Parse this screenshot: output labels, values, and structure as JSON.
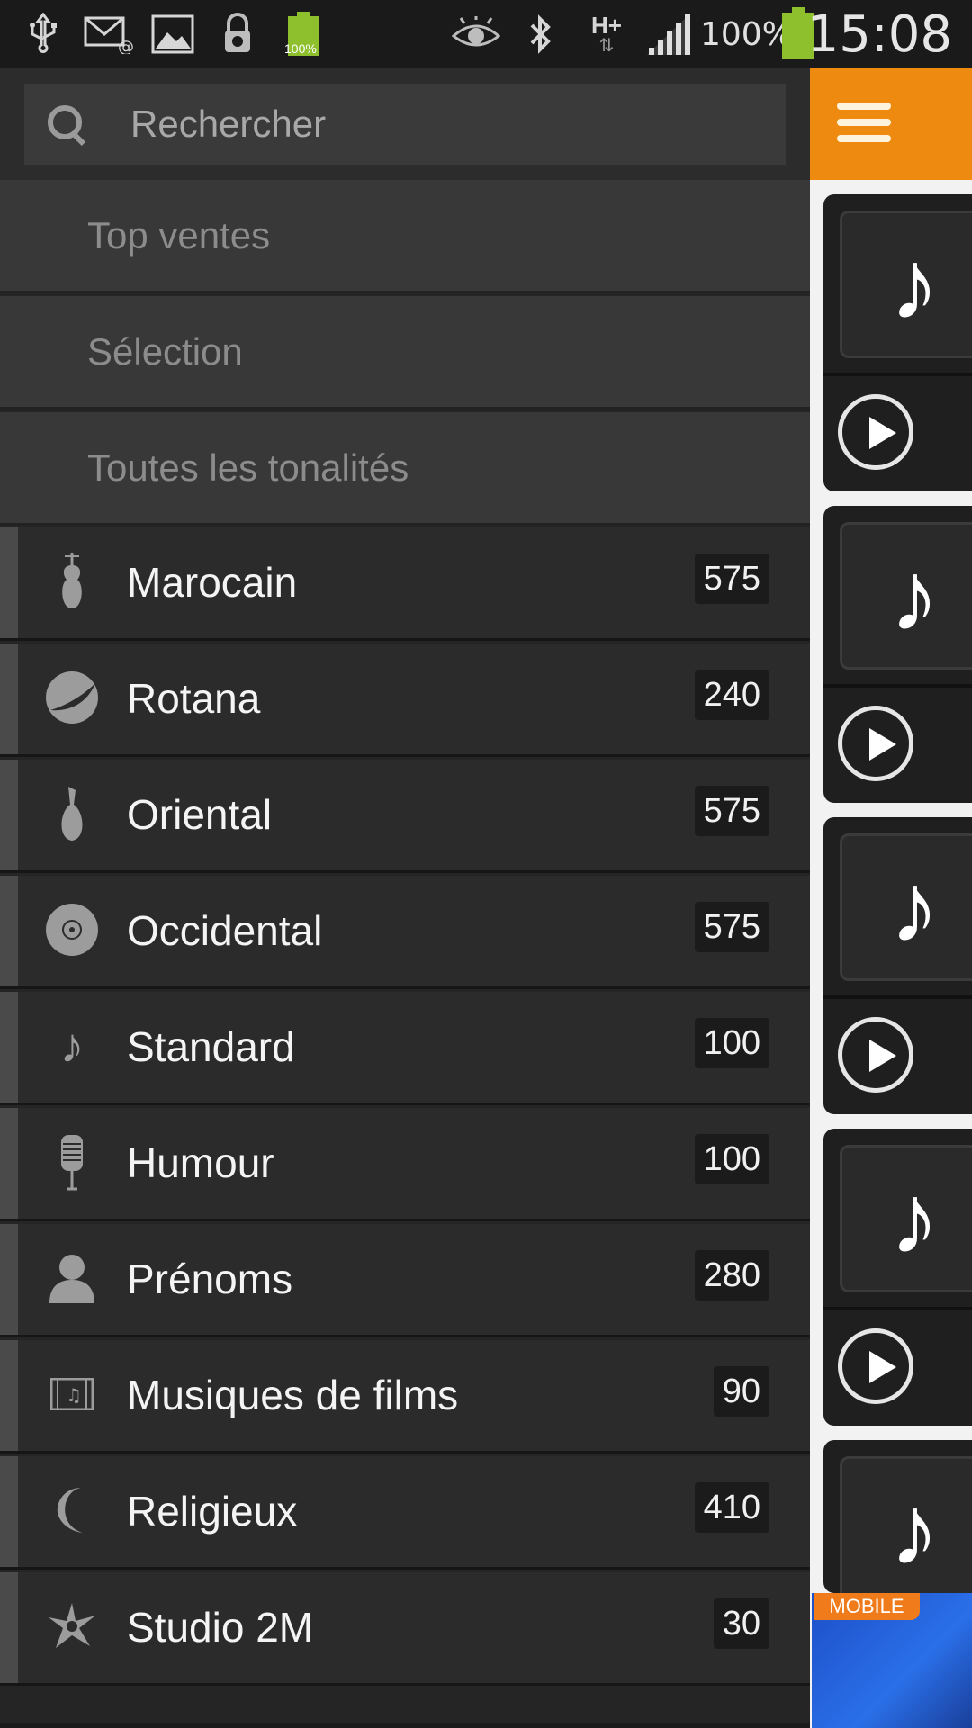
{
  "status_bar": {
    "battery_small_label": "100%",
    "network_label": "H+",
    "battery_percent": "100%",
    "time": "15:08",
    "icons": [
      "usb-icon",
      "email-icon",
      "image-icon",
      "lock-icon",
      "battery-icon",
      "eye-icon",
      "bluetooth-icon",
      "network-icon",
      "signal-icon",
      "battery-icon"
    ],
    "battery_color": "#8ec02d"
  },
  "drawer": {
    "search": {
      "placeholder": "Rechercher"
    },
    "menu": [
      {
        "label": "Top ventes"
      },
      {
        "label": "Sélection"
      },
      {
        "label": "Toutes les tonalités"
      }
    ],
    "categories": [
      {
        "label": "Marocain",
        "count": "575",
        "icon": "violin-icon"
      },
      {
        "label": "Rotana",
        "count": "240",
        "icon": "rotana-logo-icon"
      },
      {
        "label": "Oriental",
        "count": "575",
        "icon": "oud-icon"
      },
      {
        "label": "Occidental",
        "count": "575",
        "icon": "disc-icon"
      },
      {
        "label": "Standard",
        "count": "100",
        "icon": "music-note-icon"
      },
      {
        "label": "Humour",
        "count": "100",
        "icon": "microphone-icon"
      },
      {
        "label": "Prénoms",
        "count": "280",
        "icon": "person-icon"
      },
      {
        "label": "Musiques de films",
        "count": "90",
        "icon": "film-icon"
      },
      {
        "label": "Religieux",
        "count": "410",
        "icon": "crescent-icon"
      },
      {
        "label": "Studio 2M",
        "count": "30",
        "icon": "star-burst-icon"
      }
    ]
  },
  "behind": {
    "accent_color": "#ee8a0f",
    "ad_tag": "MOBILE"
  }
}
